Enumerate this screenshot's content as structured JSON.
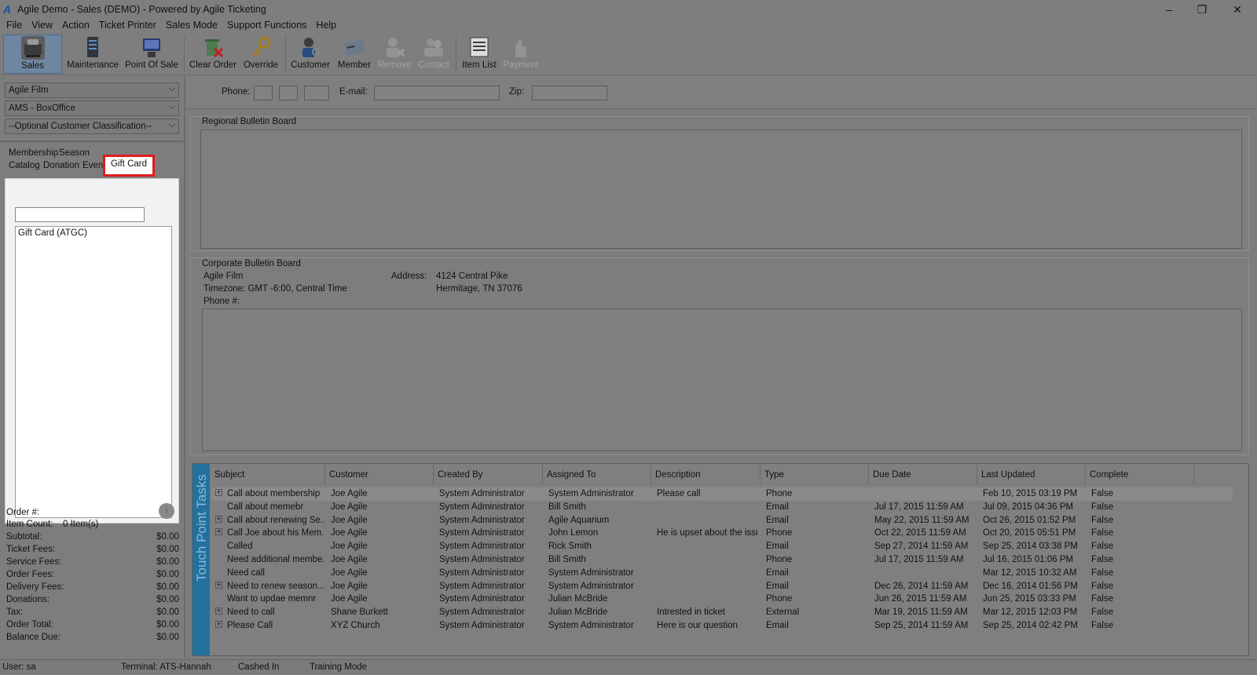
{
  "window": {
    "title": "Agile Demo - Sales (DEMO) - Powered by Agile Ticketing",
    "controls": [
      "–",
      "❐",
      "✕"
    ]
  },
  "menu": [
    "File",
    "View",
    "Action",
    "Ticket Printer",
    "Sales Mode",
    "Support Functions",
    "Help"
  ],
  "toolbar": {
    "buttons": [
      {
        "label": "Sales",
        "icon": "cash-register-icon",
        "active": true
      },
      {
        "label": "Maintenance",
        "icon": "server-icon"
      },
      {
        "label": "Point Of Sale",
        "icon": "pos-terminal-icon"
      },
      {
        "label": "Clear Order",
        "icon": "trash-clear-icon"
      },
      {
        "label": "Override",
        "icon": "key-icon"
      },
      {
        "label": "Customer",
        "icon": "customer-search-icon"
      },
      {
        "label": "Member",
        "icon": "member-card-icon"
      },
      {
        "label": "Remove",
        "icon": "remove-user-icon",
        "disabled": true
      },
      {
        "label": "Contact",
        "icon": "contact-icon",
        "disabled": true
      },
      {
        "label": "Item List",
        "icon": "item-list-icon"
      },
      {
        "label": "Payment",
        "icon": "payment-hand-icon",
        "disabled": true
      }
    ]
  },
  "left": {
    "dropdowns": [
      "Agile Film",
      "AMS - BoxOffice",
      "--Optional Customer Classification--"
    ],
    "tabs_row1": [
      "Membership",
      "Season"
    ],
    "tabs_row2": [
      "Catalog",
      "Donation",
      "Even"
    ],
    "active_tab": "Gift Card",
    "search_value": "",
    "items": [
      "Gift Card  (ATGC)"
    ],
    "summary": {
      "order_label": "Order #:",
      "item_count_label": "Item Count:",
      "item_count_value": "0 Item(s)",
      "rows": [
        {
          "label": "Subtotal:",
          "value": "$0.00"
        },
        {
          "label": "Ticket Fees:",
          "value": "$0.00"
        },
        {
          "label": "Service Fees:",
          "value": "$0.00"
        },
        {
          "label": "Order Fees:",
          "value": "$0.00"
        },
        {
          "label": "Delivery Fees:",
          "value": "$0.00"
        },
        {
          "label": "Donations:",
          "value": "$0.00"
        },
        {
          "label": "Tax:",
          "value": "$0.00"
        },
        {
          "label": "Order Total:",
          "value": "$0.00"
        },
        {
          "label": "Balance Due:",
          "value": "$0.00"
        }
      ]
    }
  },
  "contact": {
    "phone_label": "Phone:",
    "email_label": "E-mail:",
    "zip_label": "Zip:"
  },
  "regional": {
    "title": "Regional Bulletin Board"
  },
  "corporate": {
    "title": "Corporate Bulletin Board",
    "org": "Agile Film",
    "timezone": "Timezone: GMT -6:00, Central Time",
    "phone": "Phone #:",
    "address_label": "Address:",
    "address1": "4124 Central Pike",
    "address2": "Hermitage, TN 37076"
  },
  "tasks": {
    "side_label": "Touch Point Tasks",
    "columns": [
      "Subject",
      "Customer",
      "Created By",
      "Assigned To",
      "Description",
      "Type",
      "Due Date",
      "Last Updated",
      "Complete"
    ],
    "rows": [
      {
        "exp": true,
        "subject": "Call about membership",
        "customer": "Joe Agile",
        "created": "System Administrator",
        "assigned": "System Administrator",
        "desc": "Please call",
        "type": "Phone",
        "due": "",
        "updated": "Feb 10, 2015 03:19 PM",
        "complete": "False"
      },
      {
        "exp": false,
        "subject": "Call about memebr",
        "customer": "Joe Agile",
        "created": "System Administrator",
        "assigned": "Bill Smith",
        "desc": "",
        "type": "Email",
        "due": "Jul 17, 2015 11:59 AM",
        "updated": "Jul 09, 2015 04:36 PM",
        "complete": "False"
      },
      {
        "exp": true,
        "subject": "Call about renewing Se...",
        "customer": "Joe Agile",
        "created": "System Administrator",
        "assigned": "Agile Aquarium",
        "desc": "",
        "type": "Email",
        "due": "May 22, 2015 11:59 AM",
        "updated": "Oct 26, 2015 01:52 PM",
        "complete": "False"
      },
      {
        "exp": true,
        "subject": "Call Joe about his Mem...",
        "customer": "Joe Agile",
        "created": "System Administrator",
        "assigned": "John Lemon",
        "desc": "He is upset about the issu...",
        "type": "Phone",
        "due": "Oct 22, 2015 11:59 AM",
        "updated": "Oct 20, 2015 05:51 PM",
        "complete": "False"
      },
      {
        "exp": false,
        "subject": "Called",
        "customer": "Joe Agile",
        "created": "System Administrator",
        "assigned": "Rick Smith",
        "desc": "",
        "type": "Email",
        "due": "Sep 27, 2014 11:59 AM",
        "updated": "Sep 25, 2014 03:38 PM",
        "complete": "False"
      },
      {
        "exp": false,
        "subject": "Need additional membe...",
        "customer": "Joe Agile",
        "created": "System Administrator",
        "assigned": "Bill Smith",
        "desc": "",
        "type": "Phone",
        "due": "Jul 17, 2015 11:59 AM",
        "updated": "Jul 16, 2015 01:06 PM",
        "complete": "False"
      },
      {
        "exp": false,
        "subject": "Need call",
        "customer": "Joe Agile",
        "created": "System Administrator",
        "assigned": "System Administrator",
        "desc": "",
        "type": "Email",
        "due": "",
        "updated": "Mar 12, 2015 10:32 AM",
        "complete": "False"
      },
      {
        "exp": true,
        "subject": "Need to renew season...",
        "customer": "Joe Agile",
        "created": "System Administrator",
        "assigned": "System Administrator",
        "desc": "",
        "type": "Email",
        "due": "Dec 26, 2014 11:59 AM",
        "updated": "Dec 16, 2014 01:56 PM",
        "complete": "False"
      },
      {
        "exp": false,
        "subject": "Want to updae memnr",
        "customer": "Joe Agile",
        "created": "System Administrator",
        "assigned": "Julian McBride",
        "desc": "",
        "type": "Phone",
        "due": "Jun 26, 2015 11:59 AM",
        "updated": "Jun 25, 2015 03:33 PM",
        "complete": "False"
      },
      {
        "exp": true,
        "subject": "Need to call",
        "customer": "Shane Burkett",
        "created": "System Administrator",
        "assigned": "Julian McBride",
        "desc": "Intrested in ticket",
        "type": "External",
        "due": "Mar 19, 2015 11:59 AM",
        "updated": "Mar 12, 2015 12:03 PM",
        "complete": "False"
      },
      {
        "exp": true,
        "subject": "Please Call",
        "customer": "XYZ Church",
        "created": "System Administrator",
        "assigned": "System Administrator",
        "desc": "Here is our question",
        "type": "Email",
        "due": "Sep 25, 2014 11:59 AM",
        "updated": "Sep 25, 2014 02:42 PM",
        "complete": "False"
      }
    ]
  },
  "status": {
    "user": "User: sa",
    "terminal": "Terminal: ATS-Hannah",
    "cashed": "Cashed In",
    "mode": "Training Mode"
  },
  "colors": {
    "highlight": "#e31b1b",
    "tasks_side": "#23709d"
  }
}
